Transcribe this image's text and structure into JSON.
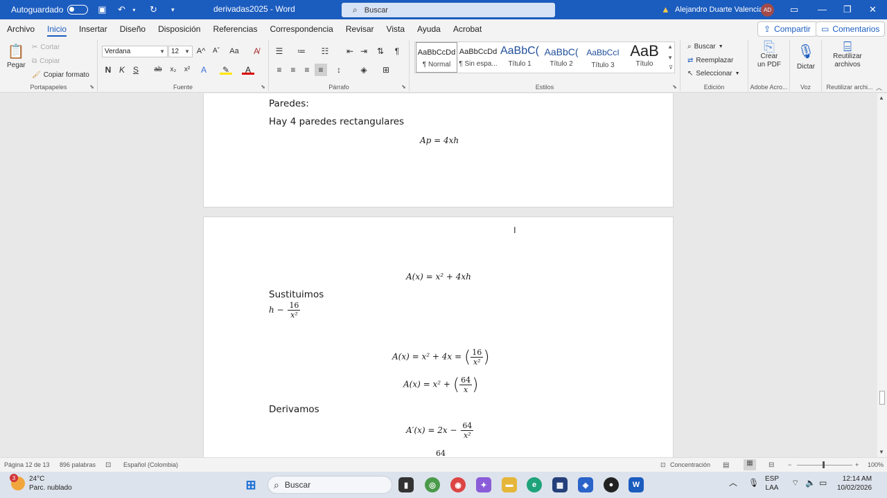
{
  "titlebar": {
    "autosave_label": "Autoguardado",
    "doc_title": "derivadas2025  -  Word",
    "search_placeholder": "Buscar",
    "user_name": "Alejandro Duarte Valencia",
    "user_initials": "AD"
  },
  "menu": {
    "tabs": [
      "Archivo",
      "Inicio",
      "Insertar",
      "Diseño",
      "Disposición",
      "Referencias",
      "Correspondencia",
      "Revisar",
      "Vista",
      "Ayuda",
      "Acrobat"
    ],
    "active": "Inicio",
    "share": "Compartir",
    "comments": "Comentarios"
  },
  "ribbon": {
    "clipboard": {
      "paste": "Pegar",
      "cut": "Cortar",
      "copy": "Copiar",
      "format_painter": "Copiar formato",
      "label": "Portapapeles"
    },
    "font": {
      "name": "Verdana",
      "size": "12",
      "bold": "N",
      "italic": "K",
      "underline": "S",
      "strike": "ab",
      "sub": "x₂",
      "sup": "x²",
      "label": "Fuente"
    },
    "paragraph": {
      "label": "Párrafo"
    },
    "styles": {
      "label": "Estilos",
      "items": [
        {
          "preview": "AaBbCcDd",
          "name": "¶ Normal"
        },
        {
          "preview": "AaBbCcDd",
          "name": "¶ Sin espa..."
        },
        {
          "preview": "AaBbC(",
          "name": "Título 1"
        },
        {
          "preview": "AaBbC(",
          "name": "Título 2"
        },
        {
          "preview": "AaBbCcI",
          "name": "Título 3"
        },
        {
          "preview": "AaB",
          "name": "Título"
        }
      ]
    },
    "editing": {
      "find": "Buscar",
      "replace": "Reemplazar",
      "select": "Seleccionar",
      "label": "Edición"
    },
    "adobe": {
      "create_pdf": "Crear un PDF",
      "label": "Adobe Acro..."
    },
    "voice": {
      "dictate": "Dictar",
      "label": "Voz"
    },
    "reuse": {
      "btn": "Reutilizar archivos",
      "label": "Reutilizar archi..."
    }
  },
  "document": {
    "page1": {
      "p1": "Paredes:",
      "p2": "Hay 4 paredes rectangulares",
      "eq1": "Ap = 4xh"
    },
    "page2": {
      "eq_area": "A(x) = x² + 4xh",
      "p_sust": "Sustituimos",
      "h_lhs": "h −",
      "frac16_num": "16",
      "frac16_den": "x²",
      "eq2_lhs": "A(x) = x² + 4x =",
      "eq3_lhs": "A(x) = x² +",
      "frac64_num": "64",
      "frac64_den": "x",
      "p_deriv": "Derivamos",
      "eq4_lhs": "A′(x) = 2x −",
      "frac64b_num": "64",
      "frac64b_den": "x²",
      "eq5_partial": "64"
    }
  },
  "statusbar": {
    "page": "Página 12 de 13",
    "words": "896 palabras",
    "language": "Español (Colombia)",
    "focus": "Concentración",
    "zoom": "100%"
  },
  "taskbar": {
    "temp": "24°C",
    "weather": "Parc. nublado",
    "weather_badge": "3",
    "search": "Buscar",
    "lang1": "ESP",
    "lang2": "LAA",
    "time": "12:14 AM",
    "date": "10/02/2026"
  }
}
